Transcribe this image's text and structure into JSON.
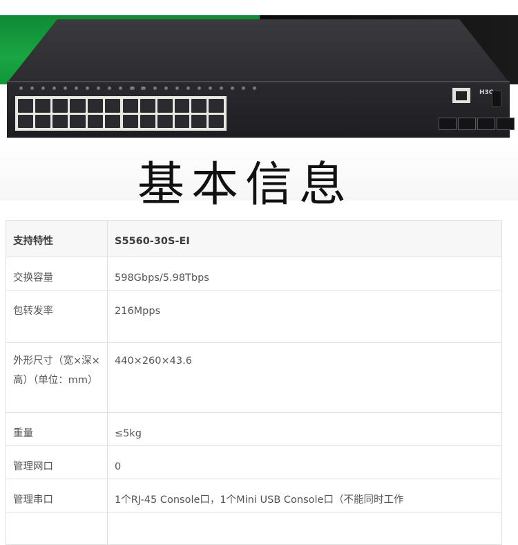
{
  "photo": {
    "brand": "H3C"
  },
  "heading": "基本信息",
  "table": {
    "header": {
      "key": "支持特性",
      "value": "S5560-30S-EI"
    },
    "rows": [
      {
        "key": "交换容量",
        "value": "598Gbps/5.98Tbps"
      },
      {
        "key": "包转发率",
        "value": "216Mpps"
      },
      {
        "key": "外形尺寸（宽×深×高）（单位：mm）",
        "value": "440×260×43.6"
      },
      {
        "key": "重量",
        "value": "≤5kg"
      },
      {
        "key": "管理网口",
        "value": "0"
      },
      {
        "key": "管理串口",
        "value": "1个RJ-45 Console口，1个Mini USB Console口（不能同时工作"
      }
    ]
  }
}
